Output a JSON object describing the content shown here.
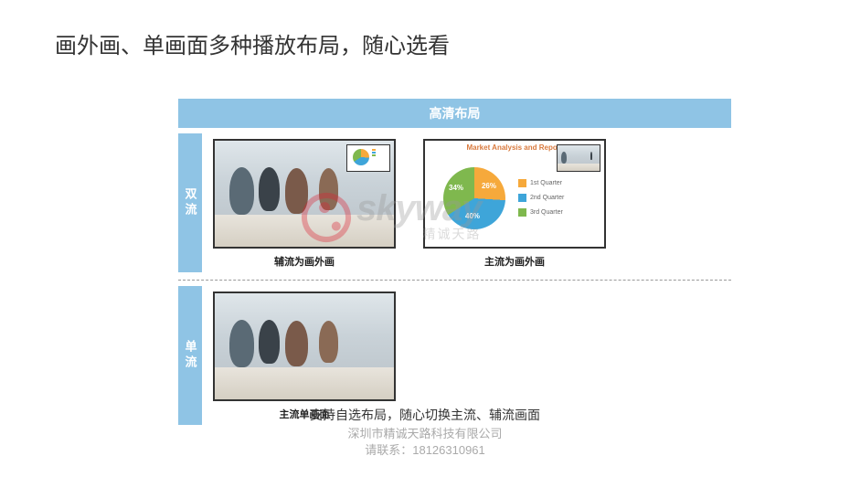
{
  "title": "画外画、单画面多种播放布局，随心选看",
  "header": "高清布局",
  "rows": {
    "dual": {
      "label": "双流",
      "cells": {
        "left": {
          "caption": "辅流为画外画"
        },
        "right": {
          "caption": "主流为画外画"
        }
      }
    },
    "single": {
      "label": "单流",
      "cells": {
        "left": {
          "caption": "主流单画面"
        }
      }
    }
  },
  "footnote": "支持自选布局，随心切换主流、辅流画面",
  "watermark": {
    "brand": "skyway",
    "sub": "精诚天路"
  },
  "contact": {
    "line1": "深圳市精诚天路科技有限公司",
    "line2": "请联系：18126310961"
  },
  "chart_data": {
    "type": "pie",
    "title": "Market Analysis and Report",
    "series": [
      {
        "name": "1st Quarter",
        "value": 26,
        "label": "26%",
        "color": "#f6a93b"
      },
      {
        "name": "2nd Quarter",
        "value": 40,
        "label": "40%",
        "color": "#3ea5d9"
      },
      {
        "name": "3rd Quarter",
        "value": 34,
        "label": "34%",
        "color": "#7fb84e"
      }
    ]
  }
}
